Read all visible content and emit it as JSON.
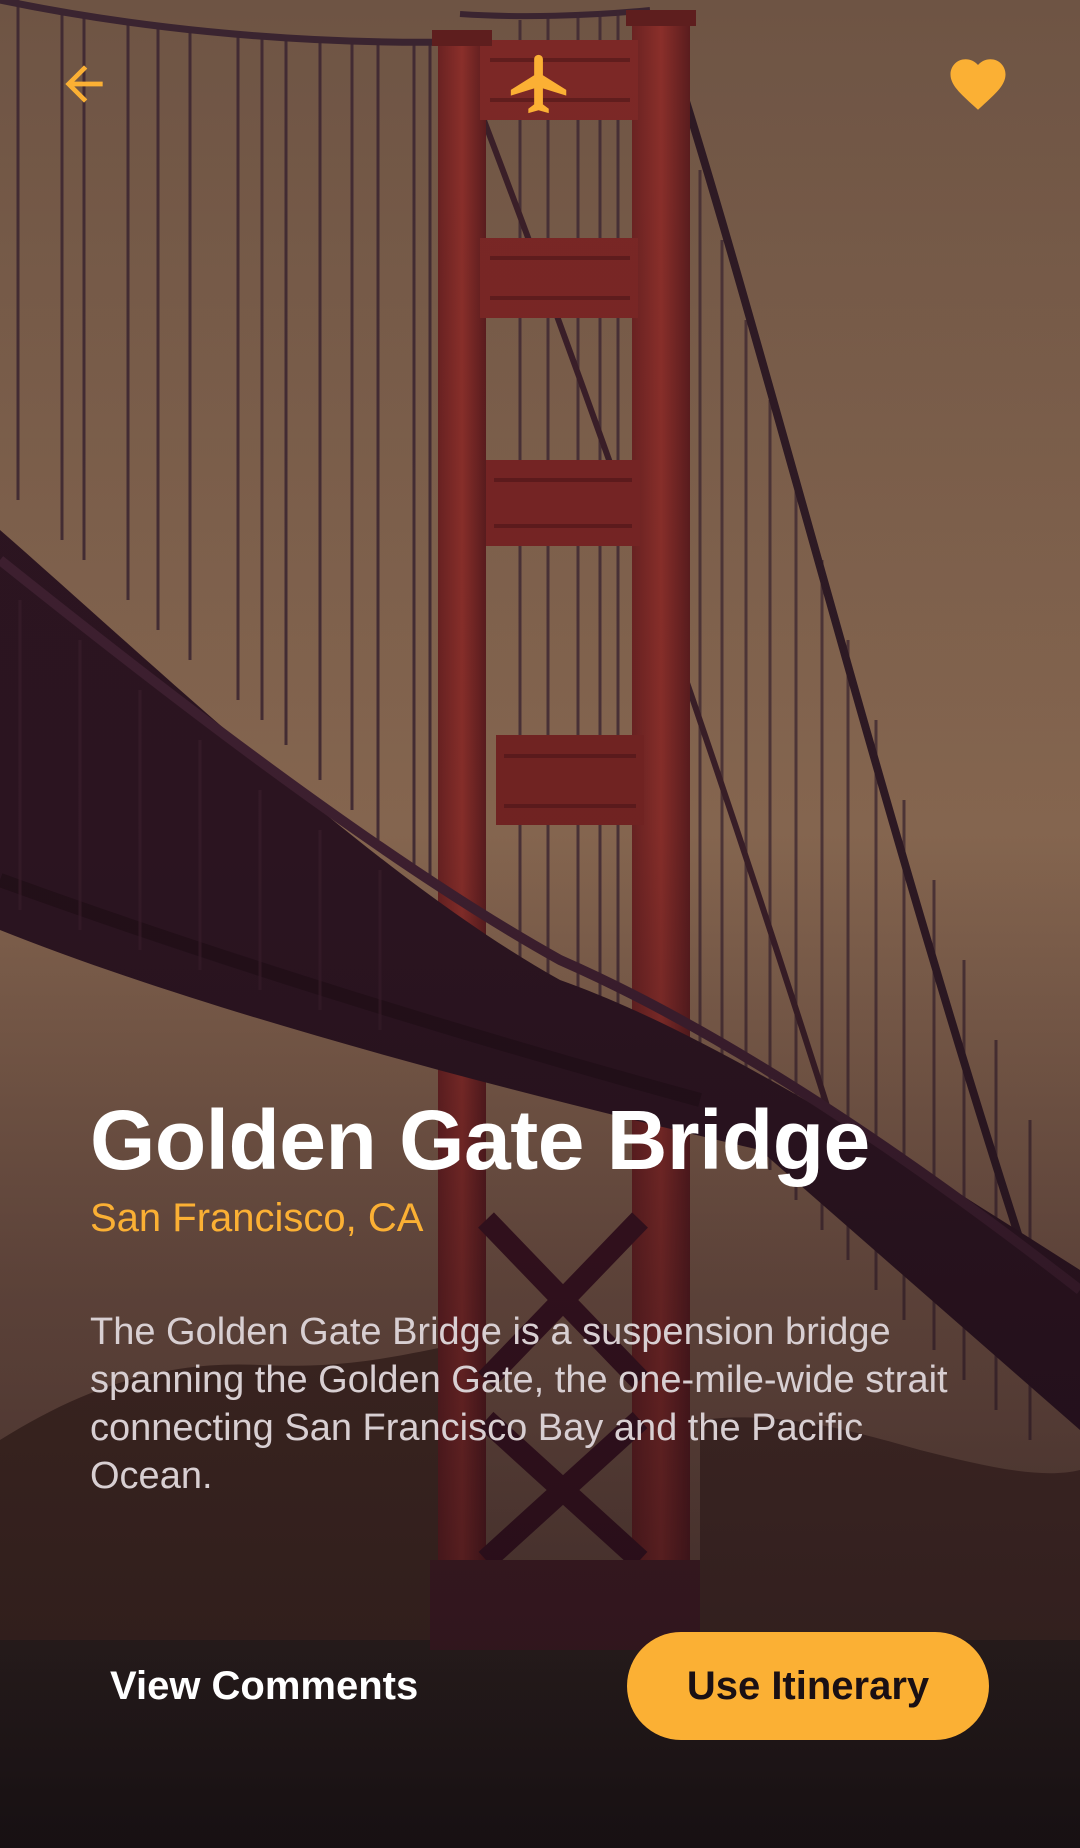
{
  "colors": {
    "accent": "#fbb034",
    "title": "#ffffff",
    "body_text": "#d8cfd2",
    "tint": "#5a3a34"
  },
  "header": {
    "back_icon": "arrow-left-icon",
    "center_icon": "airplane-icon",
    "favorite_icon": "heart-icon"
  },
  "place": {
    "name": "Golden Gate Bridge",
    "location": "San Francisco, CA",
    "description": "The Golden Gate Bridge is a suspension bridge spanning the Golden Gate, the one-mile-wide strait connecting San Francisco Bay and the Pacific Ocean."
  },
  "actions": {
    "comments_label": "View Comments",
    "itinerary_label": "Use Itinerary"
  }
}
